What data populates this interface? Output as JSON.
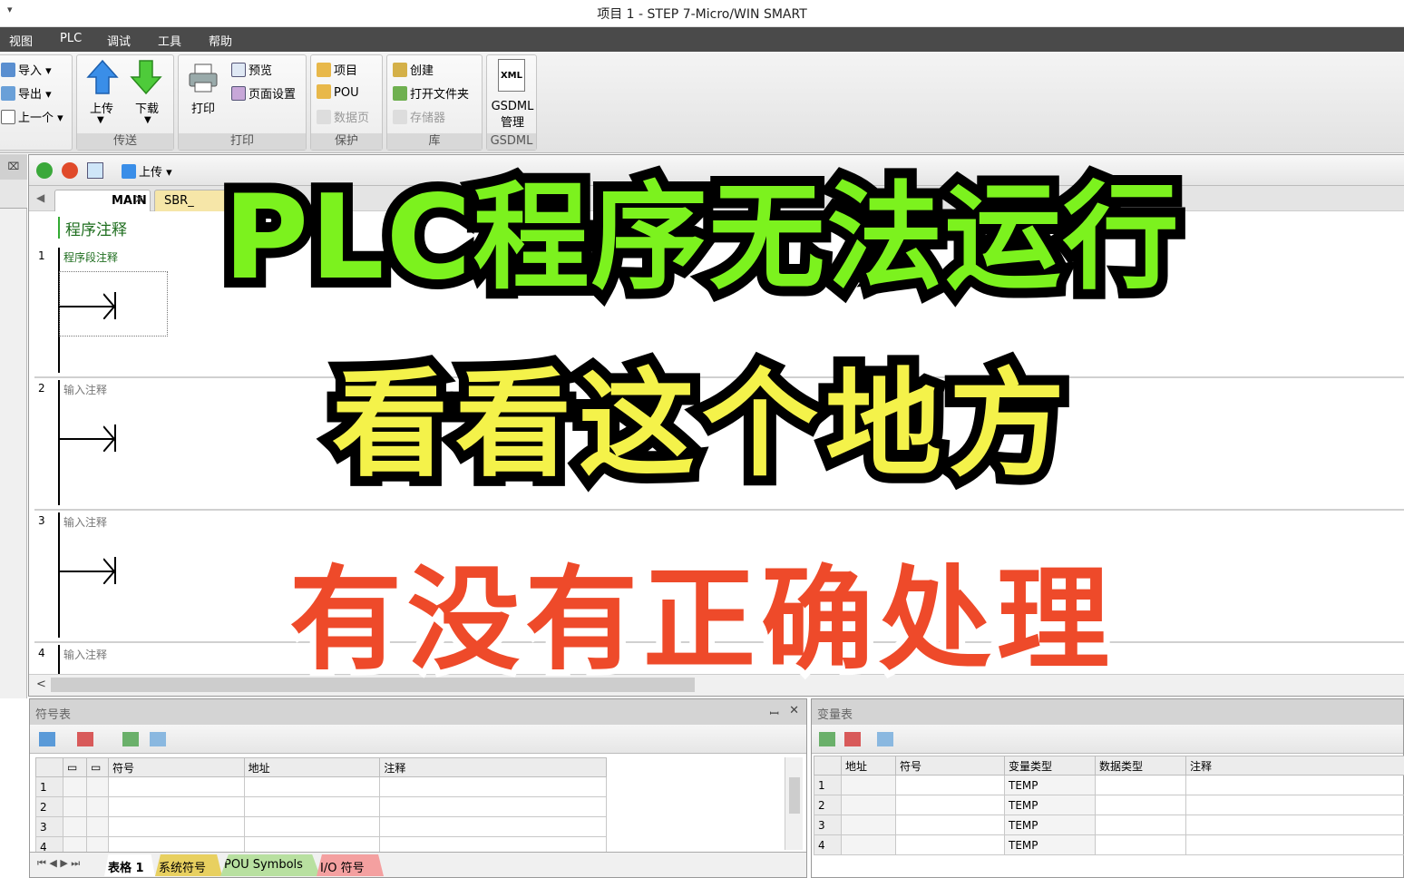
{
  "window": {
    "title": "项目 1 - STEP 7-Micro/WIN SMART",
    "qa_icon": "quick-access-dropdown"
  },
  "menu": [
    "视图",
    "PLC",
    "调试",
    "工具",
    "帮助"
  ],
  "ribbon": {
    "groups": {
      "transfer": {
        "label": "传送",
        "upload": "上传",
        "download": "下载"
      },
      "print": {
        "label": "打印",
        "print": "打印",
        "preview": "预览",
        "page_setup": "页面设置"
      },
      "protect": {
        "label": "保护",
        "project": "项目",
        "pou": "POU",
        "datapage": "数据页"
      },
      "library": {
        "label": "库",
        "create": "创建",
        "open_folder": "打开文件夹",
        "memory": "存储器"
      },
      "gsdml": {
        "label": "GSDML",
        "manage": "GSDML 管理",
        "xml": "XML"
      }
    },
    "left_items": {
      "import": "导入",
      "export": "导出",
      "previous": "上一个"
    }
  },
  "editor": {
    "toolbar": {
      "upload": "上传"
    },
    "tabs": [
      "MAIN",
      "SBR_"
    ],
    "program_comment": "程序注释",
    "networks": [
      {
        "num": "1",
        "comment": "程序段注释"
      },
      {
        "num": "2",
        "comment": "输入注释"
      },
      {
        "num": "3",
        "comment": "输入注释"
      },
      {
        "num": "4",
        "comment": "输入注释"
      }
    ]
  },
  "symbol_table": {
    "title": "符号表",
    "columns": [
      "符号",
      "地址",
      "注释"
    ],
    "rows": [
      "1",
      "2",
      "3",
      "4"
    ],
    "sheet_tabs": [
      "表格 1",
      "系统符号",
      "POU Symbols",
      "I/O 符号"
    ]
  },
  "variable_table": {
    "title": "变量表",
    "columns": [
      "地址",
      "符号",
      "变量类型",
      "数据类型",
      "注释"
    ],
    "rows": [
      {
        "n": "1",
        "type": "TEMP"
      },
      {
        "n": "2",
        "type": "TEMP"
      },
      {
        "n": "3",
        "type": "TEMP"
      },
      {
        "n": "4",
        "type": "TEMP"
      }
    ]
  },
  "overlay": {
    "line1": "PLC程序无法运行",
    "line2": "看看这个地方",
    "line3": "有没有正确处理"
  },
  "colors": {
    "menubar": "#4a4a4a",
    "overlay1": "#7cf21e",
    "overlay2": "#f4f24a",
    "overlay3": "#ee4a2a"
  }
}
